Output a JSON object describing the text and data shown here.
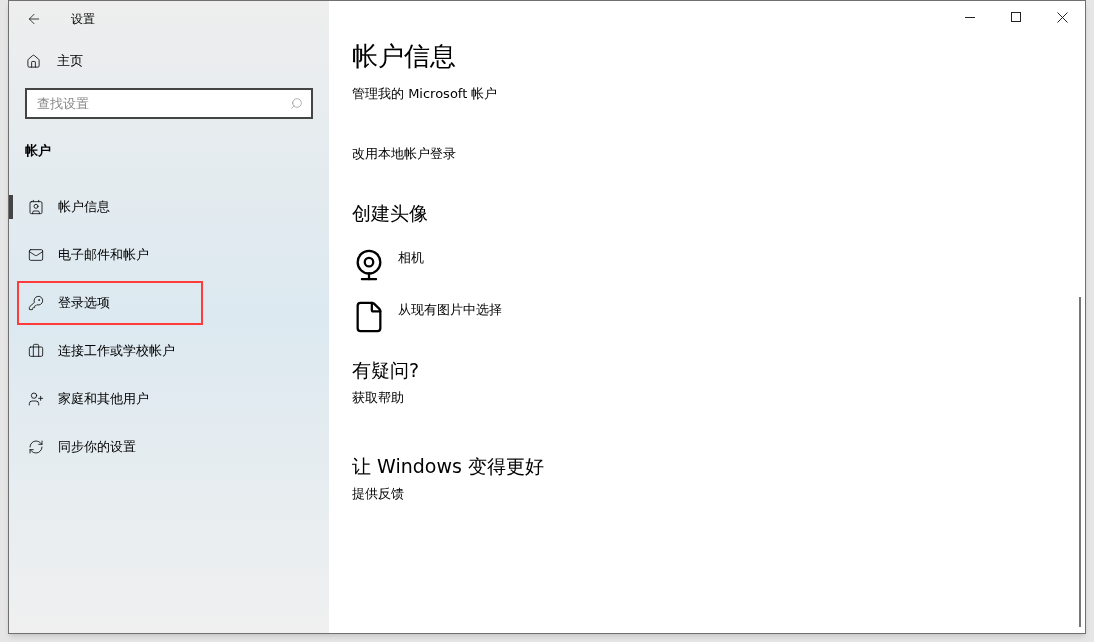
{
  "window": {
    "title": "设置"
  },
  "sidebar": {
    "home": "主页",
    "search": {
      "placeholder": "查找设置"
    },
    "section": "帐户",
    "items": [
      {
        "label": "帐户信息",
        "selected": true,
        "highlighted": false
      },
      {
        "label": "电子邮件和帐户",
        "selected": false,
        "highlighted": false
      },
      {
        "label": "登录选项",
        "selected": false,
        "highlighted": true
      },
      {
        "label": "连接工作或学校帐户",
        "selected": false,
        "highlighted": false
      },
      {
        "label": "家庭和其他用户",
        "selected": false,
        "highlighted": false
      },
      {
        "label": "同步你的设置",
        "selected": false,
        "highlighted": false
      }
    ]
  },
  "content": {
    "title": "帐户信息",
    "links": [
      "管理我的 Microsoft 帐户",
      "改用本地帐户登录"
    ],
    "avatar_section": {
      "heading": "创建头像",
      "options": [
        {
          "label": "相机"
        },
        {
          "label": "从现有图片中选择"
        }
      ]
    },
    "help": {
      "heading": "有疑问?",
      "link": "获取帮助"
    },
    "feedback": {
      "heading": "让 Windows 变得更好",
      "link": "提供反馈"
    }
  }
}
